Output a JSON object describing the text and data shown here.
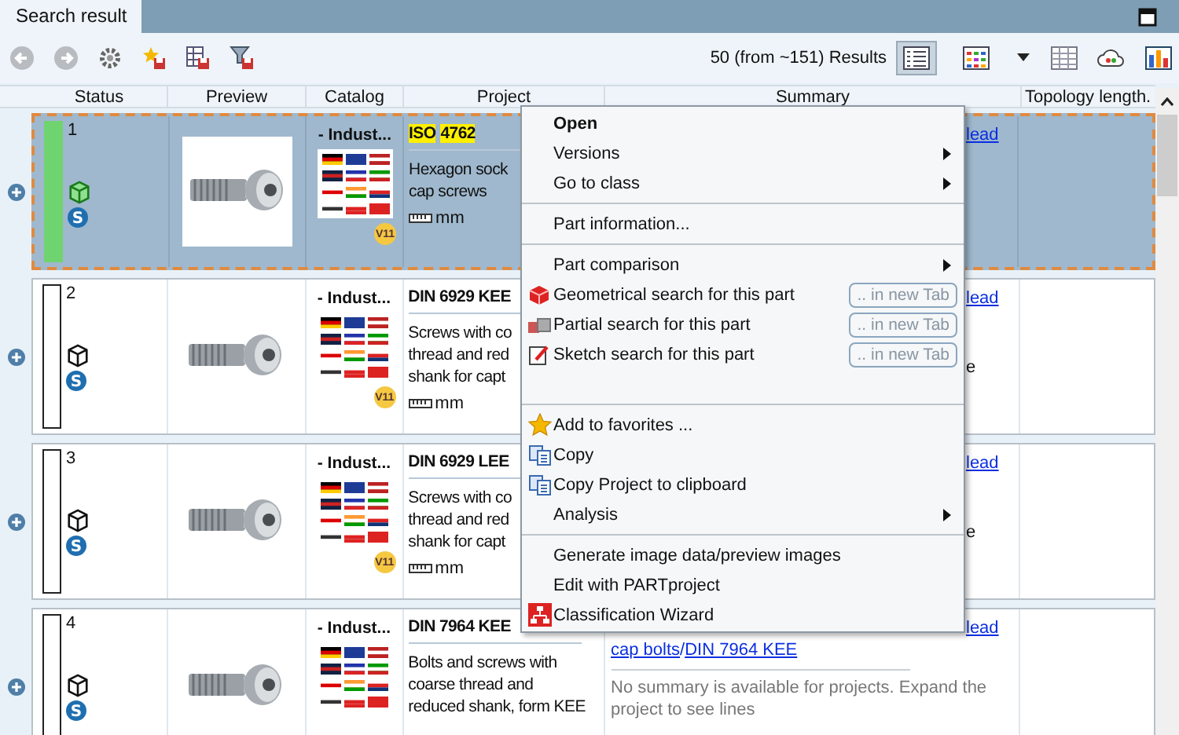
{
  "tab": {
    "label": "Search result",
    "selected": true
  },
  "toolbar": {
    "result_count": "50 (from ~151) Results",
    "views": [
      {
        "kind": "list",
        "selected": true
      },
      {
        "kind": "tiles",
        "selected": false
      }
    ]
  },
  "table": {
    "columns": [
      "Status",
      "Preview",
      "Catalog",
      "Project",
      "Summary",
      "Topology length."
    ],
    "rows": [
      {
        "selected": true,
        "number": "1",
        "color": "#6fd46f",
        "model_ready": true,
        "badge": "S",
        "catalog": "- Indust...",
        "version": "V11",
        "title": "ISO 4762",
        "highlighted": true,
        "description": [
          "Hexagon sock",
          "cap screws"
        ],
        "unit": "mm",
        "summary": [
          {
            "kind": "cut-link",
            "text": "lead"
          }
        ]
      },
      {
        "selected": false,
        "number": "2",
        "color": "#ffffff",
        "model_ready": false,
        "badge": "S",
        "catalog": "- Indust...",
        "version": "V11",
        "title": "DIN 6929 KEE",
        "highlighted": false,
        "description": [
          "Screws with co",
          "thread and red",
          "shank for capt"
        ],
        "unit": "mm",
        "summary": [
          {
            "kind": "cut-link",
            "text": "lead"
          },
          {
            "kind": "cut-text",
            "text": "e"
          }
        ]
      },
      {
        "selected": false,
        "number": "3",
        "color": "#ffffff",
        "model_ready": false,
        "badge": "S",
        "catalog": "- Indust...",
        "version": "V11",
        "title": "DIN 6929 LEE",
        "highlighted": false,
        "description": [
          "Screws with co",
          "thread and red",
          "shank for capt"
        ],
        "unit": "mm",
        "summary": [
          {
            "kind": "cut-link",
            "text": "lead"
          },
          {
            "kind": "cut-text",
            "text": "e"
          }
        ]
      },
      {
        "selected": false,
        "number": "4",
        "color": "#ffffff",
        "model_ready": false,
        "badge": "S",
        "catalog": "- Indust...",
        "version": null,
        "title": "DIN 7964 KEE",
        "highlighted": false,
        "description": [
          "Bolts and screws with",
          "coarse thread and",
          "reduced shank, form KEE"
        ],
        "unit": null,
        "summary": [
          {
            "kind": "cut-link",
            "text": "lead"
          },
          {
            "kind": "links",
            "links": [
              "cap bolts",
              "DIN 7964 KEE"
            ],
            "separator": "/"
          },
          {
            "kind": "note",
            "text": "No summary is available for projects. Expand the project to see lines"
          }
        ]
      }
    ]
  },
  "context_menu": [
    {
      "kind": "item",
      "label": "Open",
      "bold": true,
      "submenu": false
    },
    {
      "kind": "item",
      "label": "Versions",
      "bold": false,
      "submenu": true
    },
    {
      "kind": "item",
      "label": "Go to class",
      "bold": false,
      "submenu": true
    },
    {
      "kind": "separator"
    },
    {
      "kind": "item",
      "label": "Part information...",
      "bold": false,
      "submenu": false
    },
    {
      "kind": "separator"
    },
    {
      "kind": "item",
      "label": "Part comparison",
      "bold": false,
      "submenu": true
    },
    {
      "kind": "item",
      "label": "Geometrical search for this part",
      "bold": false,
      "submenu": false,
      "tab_button": ".. in new Tab"
    },
    {
      "kind": "item",
      "label": "Partial search for this part",
      "bold": false,
      "submenu": false,
      "tab_button": ".. in new Tab"
    },
    {
      "kind": "item",
      "label": "Sketch search for this part",
      "bold": false,
      "submenu": false,
      "tab_button": ".. in new Tab"
    },
    {
      "kind": "gap"
    },
    {
      "kind": "separator"
    },
    {
      "kind": "item",
      "label": "Add to favorites ...",
      "bold": false,
      "submenu": false
    },
    {
      "kind": "item",
      "label": "Copy",
      "bold": false,
      "submenu": false
    },
    {
      "kind": "item",
      "label": "Copy Project to clipboard",
      "bold": false,
      "submenu": false
    },
    {
      "kind": "item",
      "label": "Analysis",
      "bold": false,
      "submenu": true
    },
    {
      "kind": "separator"
    },
    {
      "kind": "item",
      "label": "Generate image data/preview images",
      "bold": false,
      "submenu": false
    },
    {
      "kind": "item",
      "label": "Edit with PARTproject",
      "bold": false,
      "submenu": false
    },
    {
      "kind": "item",
      "label": "Classification Wizard",
      "bold": false,
      "submenu": false
    }
  ]
}
